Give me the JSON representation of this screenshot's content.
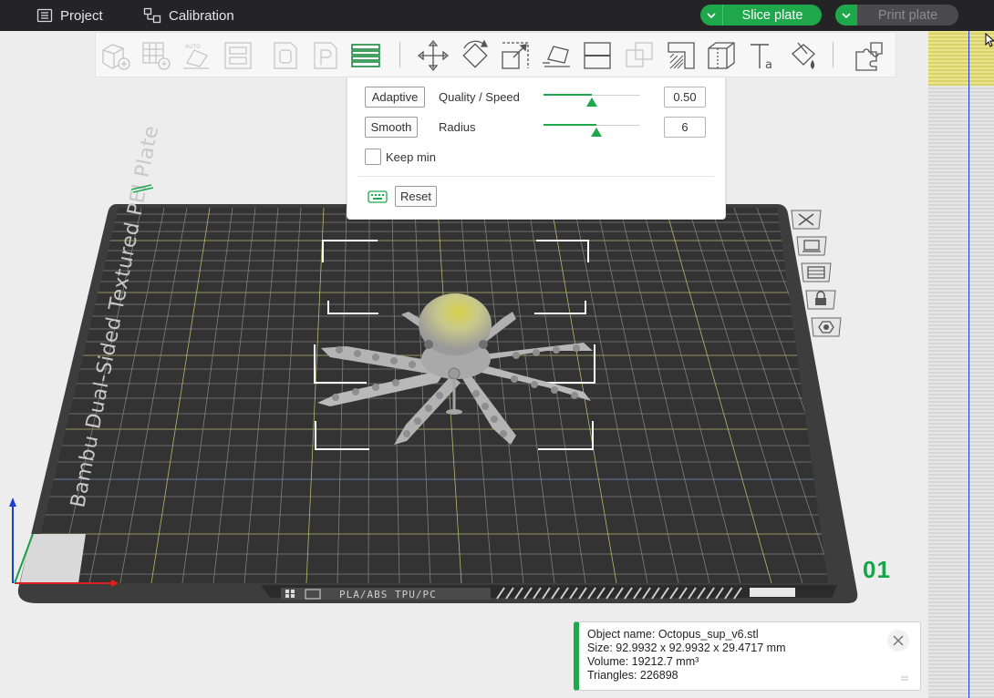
{
  "menu": {
    "project_label": "Project",
    "calibration_label": "Calibration",
    "slice_label": "Slice plate",
    "print_label": "Print plate"
  },
  "toolbar": {
    "icons": [
      "add-object-icon",
      "arrange-grid-icon",
      "auto-orient-icon",
      "plate-layout-icon",
      "object-o-icon",
      "object-p-icon",
      "variable-layer-height-icon",
      "move-icon",
      "rotate-icon",
      "scale-icon",
      "lay-on-face-icon",
      "cut-icon",
      "boolean-icon",
      "support-paint-icon",
      "seam-paint-icon",
      "text-icon",
      "color-paint-icon",
      "assembly-icon"
    ]
  },
  "popup": {
    "adaptive_label": "Adaptive",
    "quality_label": "Quality / Speed",
    "quality_value": "0.50",
    "quality_level": 0.5,
    "smooth_label": "Smooth",
    "radius_label": "Radius",
    "radius_value": "6",
    "radius_level": 0.55,
    "keep_min_label": "Keep min",
    "reset_label": "Reset"
  },
  "plate": {
    "vertical_text": "Bambu Dual-Sided Textured PEI Plate",
    "filament_text": "PLA/ABS TPU/PC",
    "plate_number": "01",
    "plate_icons": [
      "close-plate-icon",
      "arrange-plate-icon",
      "plate-settings-icon",
      "lock-plate-icon",
      "view-plate-icon"
    ]
  },
  "object_info": {
    "name_line": "Object name: Octopus_sup_v6.stl",
    "size_line": "Size: 92.9932 x 92.9932 x 29.4717 mm",
    "volume_line": "Volume: 19212.7 mm³",
    "triangles_line": "Triangles: 226898"
  },
  "colors": {
    "accent": "#1ea84b",
    "topbar": "#242426",
    "plate": "#3a3a3a"
  }
}
